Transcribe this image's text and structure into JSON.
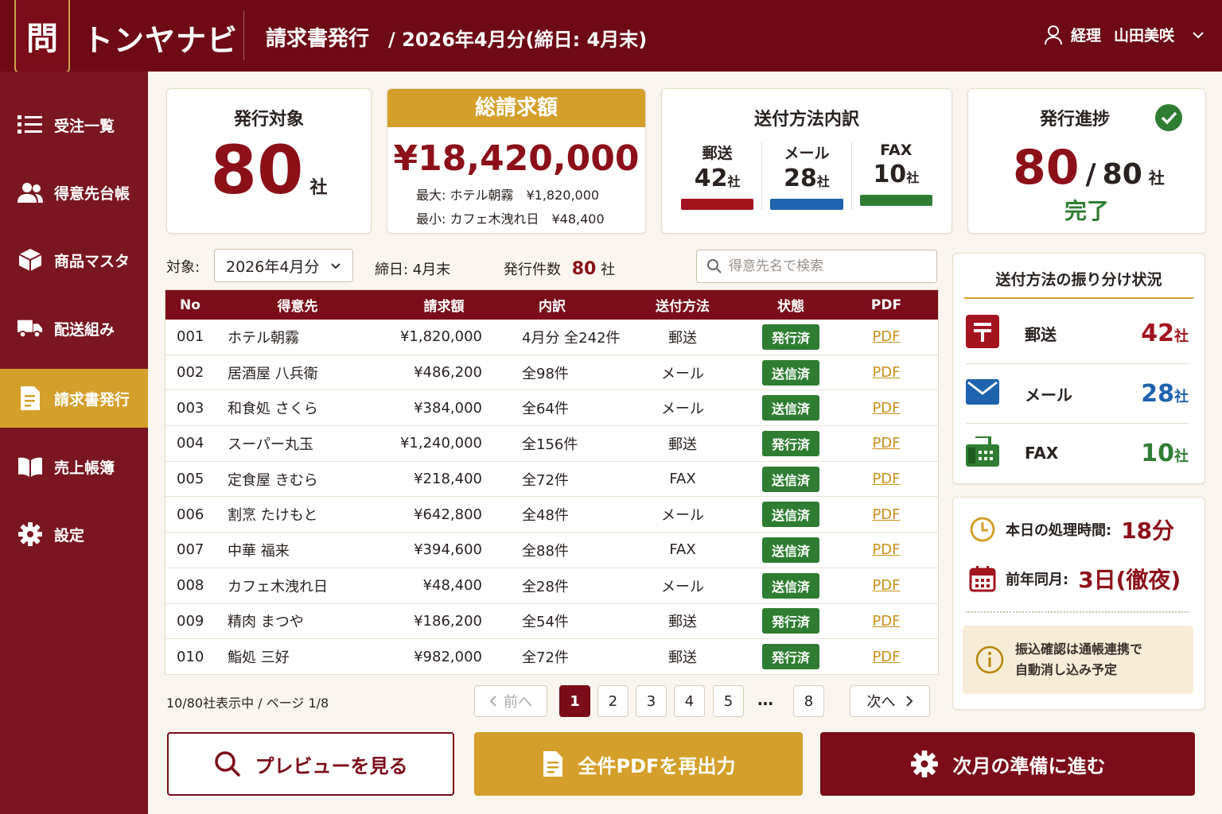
{
  "header": {
    "logo_char": "問",
    "app_name": "トンヤナビ",
    "page_title": "請求書発行",
    "period": "/ 2026年4月分(締日: 4月末)",
    "user_role": "経理",
    "user_name": "山田美咲"
  },
  "sidebar": {
    "items": [
      {
        "label": "受注一覧",
        "icon": "list-icon"
      },
      {
        "label": "得意先台帳",
        "icon": "people-icon"
      },
      {
        "label": "商品マスタ",
        "icon": "box-icon"
      },
      {
        "label": "配送組み",
        "icon": "truck-icon"
      },
      {
        "label": "請求書発行",
        "icon": "document-icon",
        "active": true
      },
      {
        "label": "売上帳簿",
        "icon": "book-icon"
      },
      {
        "label": "設定",
        "icon": "gear-icon"
      }
    ]
  },
  "summary": {
    "target": {
      "title": "発行対象",
      "value": "80",
      "unit": "社"
    },
    "total": {
      "title": "総請求額",
      "amount": "¥18,420,000",
      "max": "最大: ホテル朝霧　¥1,820,000",
      "min": "最小: カフェ木洩れ日　¥48,400"
    },
    "method": {
      "title": "送付方法内訳",
      "items": [
        {
          "label": "郵送",
          "value": "42",
          "unit": "社",
          "color": "#a3141e"
        },
        {
          "label": "メール",
          "value": "28",
          "unit": "社",
          "color": "#1e63ad"
        },
        {
          "label": "FAX",
          "value": "10",
          "unit": "社",
          "color": "#2f7d32"
        }
      ]
    },
    "progress": {
      "title": "発行進捗",
      "done": "80",
      "sep": "/",
      "total": "80",
      "unit": "社",
      "status": "完了"
    }
  },
  "filter": {
    "target_label": "対象:",
    "month_value": "2026年4月分",
    "cutoff": "締日: 4月末",
    "count_label": "発行件数",
    "count_value": "80",
    "count_unit": "社",
    "search_placeholder": "得意先名で検索"
  },
  "table": {
    "headers": [
      "No",
      "得意先",
      "請求額",
      "内訳",
      "送付方法",
      "状態",
      "PDF"
    ],
    "rows": [
      {
        "no": "001",
        "name": "ホテル朝霧",
        "amount": "¥1,820,000",
        "detail": "4月分 全242件",
        "method": "郵送",
        "status": "発行済",
        "pdf": "PDF"
      },
      {
        "no": "002",
        "name": "居酒屋 八兵衛",
        "amount": "¥486,200",
        "detail": "全98件",
        "method": "メール",
        "status": "送信済",
        "pdf": "PDF"
      },
      {
        "no": "003",
        "name": "和食処 さくら",
        "amount": "¥384,000",
        "detail": "全64件",
        "method": "メール",
        "status": "送信済",
        "pdf": "PDF"
      },
      {
        "no": "004",
        "name": "スーパー丸玉",
        "amount": "¥1,240,000",
        "detail": "全156件",
        "method": "郵送",
        "status": "発行済",
        "pdf": "PDF"
      },
      {
        "no": "005",
        "name": "定食屋 きむら",
        "amount": "¥218,400",
        "detail": "全72件",
        "method": "FAX",
        "status": "送信済",
        "pdf": "PDF"
      },
      {
        "no": "006",
        "name": "割烹 たけもと",
        "amount": "¥642,800",
        "detail": "全48件",
        "method": "メール",
        "status": "送信済",
        "pdf": "PDF"
      },
      {
        "no": "007",
        "name": "中華 福来",
        "amount": "¥394,600",
        "detail": "全88件",
        "method": "FAX",
        "status": "送信済",
        "pdf": "PDF"
      },
      {
        "no": "008",
        "name": "カフェ木洩れ日",
        "amount": "¥48,400",
        "detail": "全28件",
        "method": "メール",
        "status": "送信済",
        "pdf": "PDF"
      },
      {
        "no": "009",
        "name": "精肉 まつや",
        "amount": "¥186,200",
        "detail": "全54件",
        "method": "郵送",
        "status": "発行済",
        "pdf": "PDF"
      },
      {
        "no": "010",
        "name": "鮨処 三好",
        "amount": "¥982,000",
        "detail": "全72件",
        "method": "郵送",
        "status": "発行済",
        "pdf": "PDF"
      }
    ]
  },
  "pager": {
    "info": "10/80社表示中 / ページ 1/8",
    "prev": "前へ",
    "next": "次へ",
    "pages": [
      "1",
      "2",
      "3",
      "4",
      "5"
    ],
    "ellipsis": "…",
    "last": "8",
    "current": "1"
  },
  "distribution": {
    "title": "送付方法の振り分け状況",
    "rows": [
      {
        "label": "郵送",
        "value": "42",
        "unit": "社",
        "icon": "postal-icon",
        "color": "#a3141e"
      },
      {
        "label": "メール",
        "value": "28",
        "unit": "社",
        "icon": "mail-icon",
        "color": "#1e63ad"
      },
      {
        "label": "FAX",
        "value": "10",
        "unit": "社",
        "icon": "fax-icon",
        "color": "#2f7d32"
      }
    ]
  },
  "time": {
    "today_label": "本日の処理時間:",
    "today_value": "18分",
    "last_year_label": "前年同月:",
    "last_year_value": "3日(徹夜)",
    "notice_line1": "振込確認は通帳連携で",
    "notice_line2": "自動消し込み予定"
  },
  "actions": {
    "preview": "プレビューを見る",
    "reissue_pdf": "全件PDFを再出力",
    "next_month": "次月の準備に進む"
  }
}
